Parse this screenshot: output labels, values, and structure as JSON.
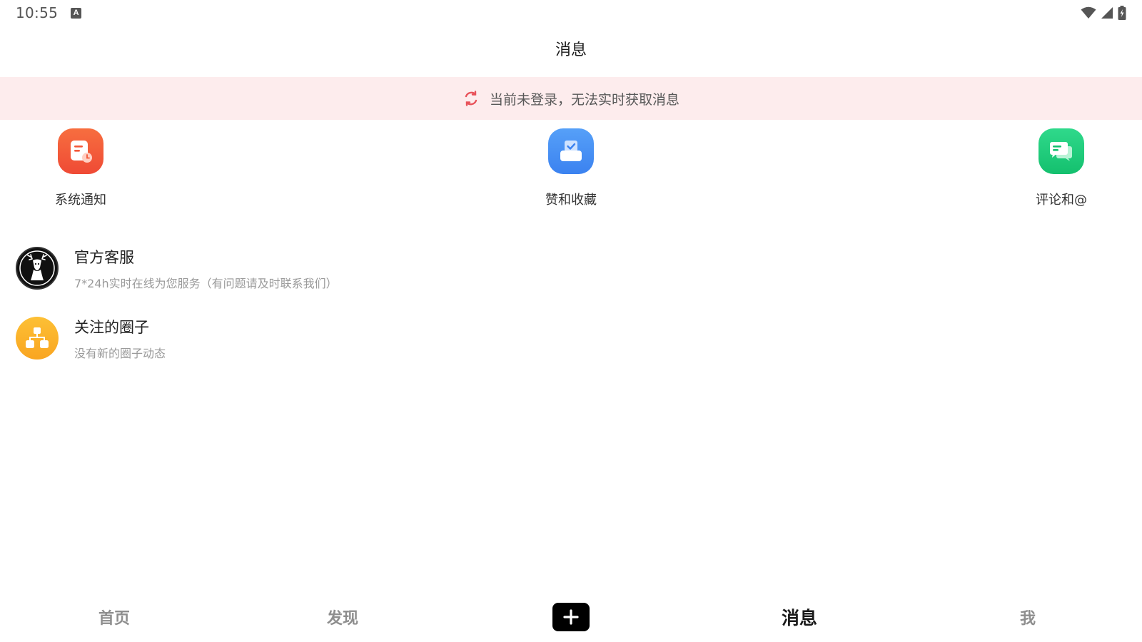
{
  "status_bar": {
    "time": "10:55",
    "notification_icon": "a-notification-icon",
    "wifi_icon": "wifi-icon",
    "signal_icon": "signal-icon",
    "battery_icon": "battery-charging-icon"
  },
  "header": {
    "title": "消息"
  },
  "login_banner": {
    "icon": "refresh-icon",
    "text": "当前未登录，无法实时获取消息",
    "background": "#fdeced",
    "icon_color": "#e8525a"
  },
  "quick_entries": [
    {
      "label": "系统通知",
      "icon": "notice-icon",
      "color": "#f3593a"
    },
    {
      "label": "赞和收藏",
      "icon": "inbox-check-icon",
      "color": "#3f8ef5"
    },
    {
      "label": "评论和@",
      "icon": "chat-bubbles-icon",
      "color": "#1fcb7a"
    }
  ],
  "messages": [
    {
      "title": "官方客服",
      "subtitle": "7*24h实时在线为您服务（有问题请及时联系我们）",
      "avatar": "deer-logo-avatar"
    },
    {
      "title": "关注的圈子",
      "subtitle": "没有新的圈子动态",
      "avatar": "circle-group-icon",
      "color": "#fbb12b"
    }
  ],
  "bottom_nav": {
    "items": [
      {
        "label": "首页"
      },
      {
        "label": "发现"
      },
      {
        "label": "",
        "icon": "plus-icon"
      },
      {
        "label": "消息",
        "active": true
      },
      {
        "label": "我"
      }
    ]
  }
}
